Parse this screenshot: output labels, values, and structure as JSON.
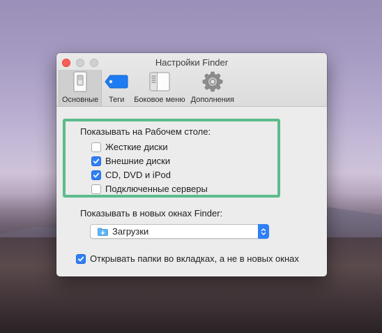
{
  "window": {
    "title": "Настройки Finder"
  },
  "toolbar": {
    "tabs": [
      {
        "label": "Основные",
        "icon": "switch-icon",
        "active": true
      },
      {
        "label": "Теги",
        "icon": "tag-icon",
        "active": false
      },
      {
        "label": "Боковое меню",
        "icon": "sidebar-icon",
        "active": false
      },
      {
        "label": "Дополнения",
        "icon": "gear-icon",
        "active": false
      }
    ]
  },
  "desktop_section": {
    "heading": "Показывать на Рабочем столе:",
    "items": [
      {
        "label": "Жесткие диски",
        "checked": false
      },
      {
        "label": "Внешние диски",
        "checked": true
      },
      {
        "label": "CD, DVD и iPod",
        "checked": true
      },
      {
        "label": "Подключенные серверы",
        "checked": false
      }
    ]
  },
  "new_window_section": {
    "heading": "Показывать в новых окнах Finder:",
    "selected": "Загрузки",
    "selected_icon": "downloads-folder-icon"
  },
  "tabs_option": {
    "label": "Открывать папки во вкладках, а не в новых окнах",
    "checked": true
  },
  "colors": {
    "accent": "#2f7ff6",
    "highlight": "#5cbc8c",
    "close_button": "#fc5f57"
  }
}
